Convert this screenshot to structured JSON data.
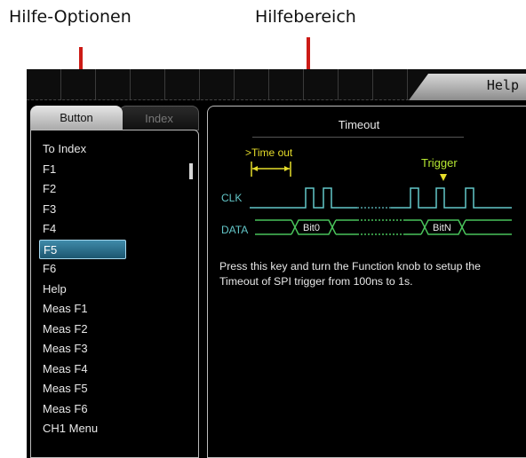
{
  "annotations": {
    "left": "Hilfe-Optionen",
    "right": "Hilfebereich"
  },
  "window": {
    "title": "Help"
  },
  "tabs": [
    {
      "label": "Button",
      "active": true
    },
    {
      "label": "Index",
      "active": false
    }
  ],
  "help_list": {
    "items": [
      "To Index",
      "F1",
      "F2",
      "F3",
      "F4",
      "F5",
      "F6",
      "Help",
      "Meas F1",
      "Meas F2",
      "Meas F3",
      "Meas F4",
      "Meas F5",
      "Meas F6",
      "CH1 Menu"
    ],
    "selected": "F5"
  },
  "content": {
    "title": "Timeout",
    "diagram": {
      "timeout_label": ">Time out",
      "trigger_label": "Trigger",
      "clk_label": "CLK",
      "data_label": "DATA",
      "bit_first": "Bit0",
      "bit_last": "BitN"
    },
    "description": "Press this key and turn the Function knob to setup the Timeout of SPI trigger from 100ns to 1s."
  },
  "colors": {
    "arrow": "#cc1b16",
    "signal": "#63c7c9",
    "data_signal": "#49c25a",
    "timeout_marker": "#e6dd2a",
    "trigger": "#b6e832",
    "selection": "#2b6e8c"
  }
}
